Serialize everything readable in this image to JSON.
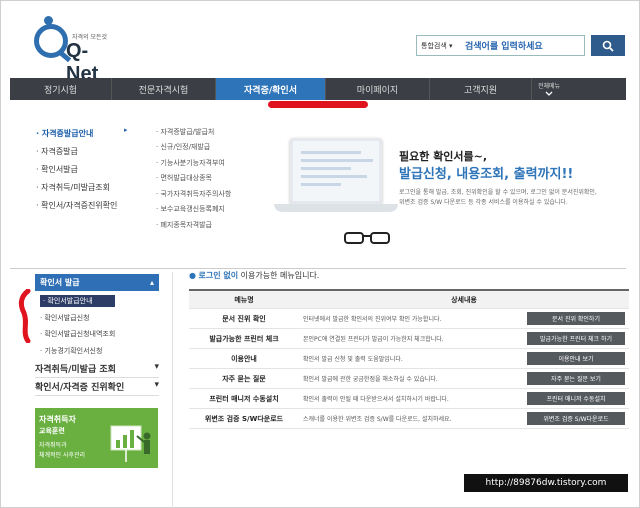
{
  "logo": {
    "subtitle": "자격의 모든것",
    "text": "Q-Net"
  },
  "search": {
    "select": "통합검색 ▾",
    "value": "검색어를 입력하세요"
  },
  "nav": {
    "items": [
      "정기시험",
      "전문자격시험",
      "자격증/확인서",
      "마이페이지",
      "고객지원"
    ],
    "active_index": 2,
    "all_menu": "전체메뉴"
  },
  "dropdown": {
    "col1": [
      "자격증발급안내",
      "자격증발급",
      "확인서발급",
      "자격취득/미발급조회",
      "확인서/자격증진위확인"
    ],
    "col1_arrow": "▸",
    "col2": [
      "자격증발급/발급처",
      "신규/인정/재발급",
      "기능사분기능자격부여",
      "면허발급대상종목",
      "국가자격취득자주의사항",
      "보수교육갱신등록폐지",
      "폐지종목자격발급"
    ]
  },
  "promo": {
    "title1": "필요한 확인서를~,",
    "title2": "발급신청, 내용조회, 출력까지!!",
    "desc1": "로그인을 통해 발급, 조회, 진위확인을 할 수 있으며, 로그인 없이 문서진위확인,",
    "desc2": "위변조 검증 S/W 다운로드 등 각종 서비스를 이용하실 수 있습니다."
  },
  "sidebar": {
    "header": "확인서 발급",
    "header_icon": "▴",
    "sub_items": [
      "확인서발급안내",
      "확인서발급신청",
      "확인서발급신청내역조회",
      "기능경기확인서신청"
    ],
    "selected_index": 0,
    "groups": [
      {
        "label": "자격취득/미발급 조회",
        "chevron": "▾"
      },
      {
        "label": "확인서/자격증 진위확인",
        "chevron": "▾"
      }
    ]
  },
  "banner": {
    "line1": "자격취득자",
    "line2": "교육훈련",
    "line3": "자격취득과",
    "line4": "체계적인 사후관리"
  },
  "main": {
    "notice_bullet": "●",
    "notice_highlight": "로그인 없이",
    "notice_rest": " 이용가능한 메뉴입니다.",
    "table": {
      "headers": [
        "메뉴명",
        "상세내용"
      ],
      "rows": [
        {
          "name": "문서 진위 확인",
          "desc": "인터넷에서 발급한 확인서의 진위여부 확인 가능합니다.",
          "button": "문서 진위 확인하기"
        },
        {
          "name": "발급가능한 프린터 체크",
          "desc": "본인PC에 연결된 프린터가 발급이 가능한지 체크합니다.",
          "button": "발급가능한 프린터 체크 하기"
        },
        {
          "name": "이용안내",
          "desc": "확인서 발급 신청 및 출력 도움말입니다.",
          "button": "이용안내 보기"
        },
        {
          "name": "자주 묻는 질문",
          "desc": "확인서 발급에 관한 궁금한점을 해소하실 수 있습니다.",
          "button": "자주 묻는 질문 보기"
        },
        {
          "name": "프린터 매니저 수동설치",
          "desc": "확인서 출력이 안될 때 다운받으셔서 설치하시기 바랍니다.",
          "button": "프린터 매니저 수동설치"
        },
        {
          "name": "위변조 검증 S/W다운로드",
          "desc": "스캐너를 이용한 위변조 검증 S/W를 다운로드, 설치하세요.",
          "button": "위변조 검증 S/W다운로드"
        }
      ]
    }
  },
  "watermark": "http://89876dw.tistory.com",
  "colors": {
    "nav_bg": "#3b3f45",
    "nav_active": "#2e74b9",
    "accent_red": "#e0141e",
    "banner_green": "#6ab040"
  }
}
